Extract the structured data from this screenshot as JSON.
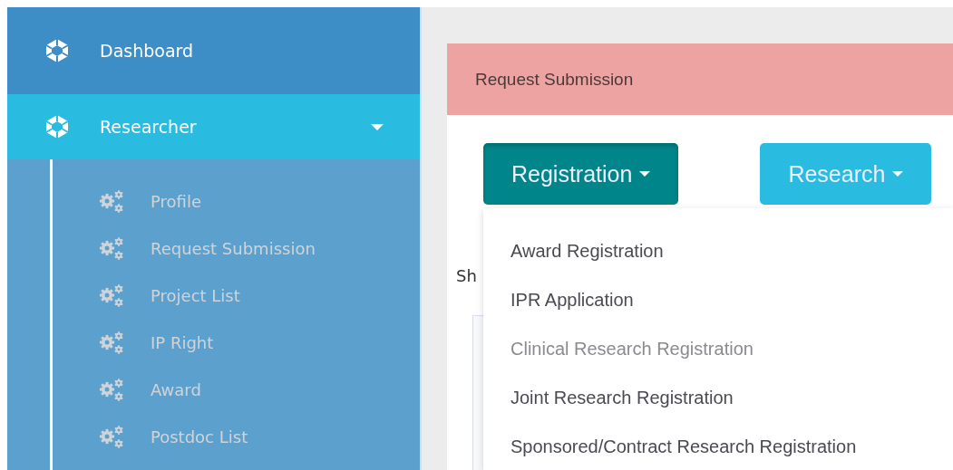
{
  "sidebar": {
    "items": [
      {
        "label": "Dashboard",
        "selected": false,
        "expanded": false
      },
      {
        "label": "Researcher",
        "selected": true,
        "expanded": true,
        "children": [
          {
            "label": "Profile"
          },
          {
            "label": "Request Submission"
          },
          {
            "label": "Project List"
          },
          {
            "label": "IP Right"
          },
          {
            "label": "Award"
          },
          {
            "label": "Postdoc List"
          }
        ]
      }
    ]
  },
  "card": {
    "title": "Request Submission",
    "buttons": [
      {
        "label": "Registration",
        "kind": "primary",
        "expanded": true
      },
      {
        "label": "Research",
        "kind": "info",
        "expanded": false
      }
    ],
    "show_text": "Sh",
    "dropdown": [
      {
        "label": "Award Registration",
        "disabled": false
      },
      {
        "label": "IPR Application",
        "disabled": false
      },
      {
        "label": "Clinical Research Registration",
        "disabled": true
      },
      {
        "label": "Joint Research Registration",
        "disabled": false
      },
      {
        "label": "Sponsored/Contract Research Registration",
        "disabled": false
      }
    ]
  }
}
